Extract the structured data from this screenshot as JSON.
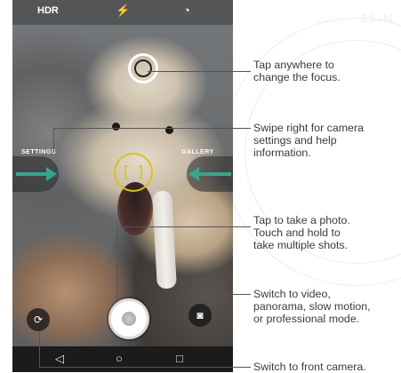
{
  "screen": {
    "top_bar": {
      "hdr_label": "HDR",
      "flash_icon": "flash-auto-icon",
      "timer_icon": "timer-icon"
    },
    "settings_label": "SETTINGS",
    "gallery_label": "GALLERY",
    "nav": {
      "back_icon": "back-icon",
      "home_icon": "home-icon",
      "recents_icon": "recents-icon"
    },
    "colors": {
      "arrow": "#3aa38f",
      "focus_yellow": "#d8c21e",
      "navbar": "#1b1b1b"
    }
  },
  "callouts": [
    {
      "text": "Tap anywhere to\nchange the focus."
    },
    {
      "text": "Swipe right for camera\nsettings and help\ninformation."
    },
    {
      "text": "Tap to take a photo.\nTouch and hold to\ntake multiple shots."
    },
    {
      "text": "Switch to video,\npanorama, slow motion,\nor professional mode."
    },
    {
      "text": "Switch to front camera."
    }
  ],
  "watermark": {
    "text": "25-N"
  }
}
